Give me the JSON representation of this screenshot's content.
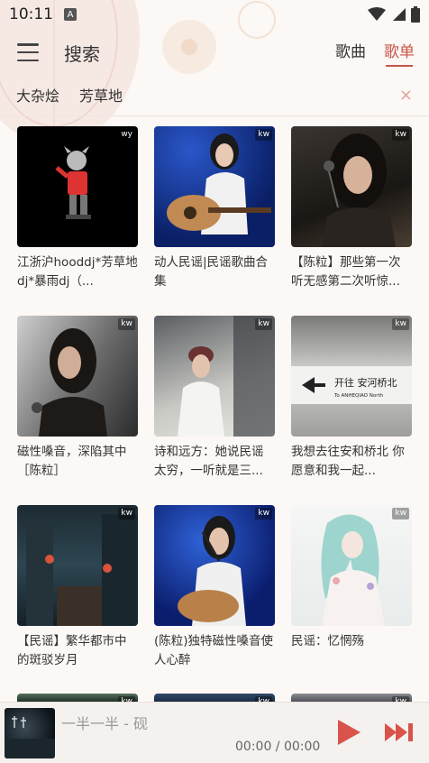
{
  "status_bar": {
    "time": "10:11",
    "notif_letter": "A"
  },
  "header": {
    "title": "搜索",
    "tabs": [
      {
        "label": "歌曲",
        "active": false
      },
      {
        "label": "歌单",
        "active": true
      }
    ]
  },
  "chips": [
    "大杂烩",
    "芳草地"
  ],
  "chip_close": "×",
  "accent_color": "#c8554b",
  "playlists": [
    {
      "title": "江浙沪hooddj*芳草地dj*暴雨dj（...",
      "source": "wy"
    },
    {
      "title": "动人民谣|民谣歌曲合集",
      "source": "kw"
    },
    {
      "title": "【陈粒】那些第一次听无感第二次听惊...",
      "source": "kw"
    },
    {
      "title": "磁性嗓音，深陷其中［陈粒］",
      "source": "kw"
    },
    {
      "title": "诗和远方：她说民谣太穷，一听就是三...",
      "source": "kw"
    },
    {
      "title": "我想去往安和桥北 你愿意和我一起...",
      "source": "kw"
    },
    {
      "title": "【民谣】繁华都市中的斑驳岁月",
      "source": "kw"
    },
    {
      "title": "(陈粒)独特磁性嗓音使人心醉",
      "source": "kw"
    },
    {
      "title": "民谣：忆惘殇",
      "source": "kw"
    }
  ],
  "partial_row_sources": [
    "kw",
    "kw",
    "kw"
  ],
  "sign_text": {
    "top": "开往 安河桥北",
    "bottom": "To ANHEQIAO North"
  },
  "player": {
    "song": "一半一半 - 砚",
    "time": "00:00 / 00:00"
  }
}
